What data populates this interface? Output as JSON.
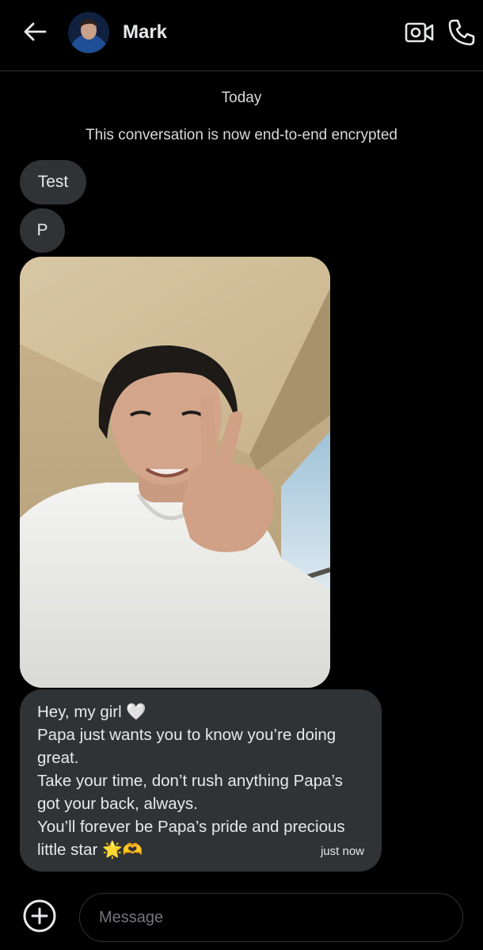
{
  "header": {
    "contact_name": "Mark",
    "icons": [
      "arrow-left-icon",
      "avatar",
      "video-camera-icon",
      "phone-icon"
    ]
  },
  "conversation": {
    "day_label": "Today",
    "system_note": "This conversation is now end-to-end encrypted",
    "messages": [
      {
        "text": "Test"
      },
      {
        "text": "P"
      },
      {
        "type": "photo"
      },
      {
        "text": "Hey, my girl 🤍\nPapa just wants you to know you’re doing great.\nTake your time, don’t rush anything  Papa’s got your back, always.\nYou’ll forever be Papa’s pride and precious little star 🌟🫶",
        "time": "just now"
      }
    ]
  },
  "composer": {
    "placeholder": "Message",
    "value": ""
  },
  "colors": {
    "background": "#000000",
    "bubble": "#2f3336",
    "text": "#e7e9ea",
    "divider": "#2f3336",
    "placeholder": "#71767b"
  }
}
